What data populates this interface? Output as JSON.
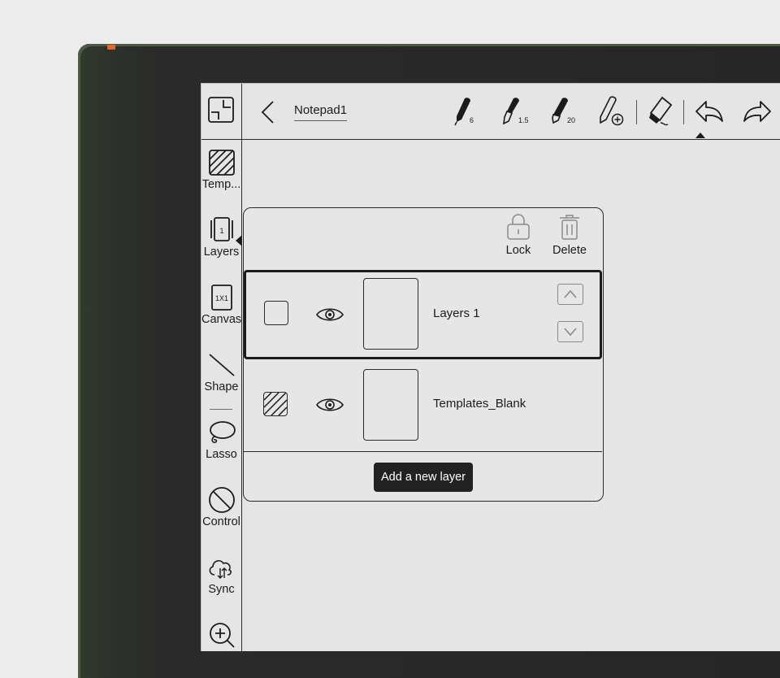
{
  "document": {
    "title": "Notepad1"
  },
  "sidebar": {
    "items": [
      {
        "label": "Temp...",
        "icon": "template-hatched-icon"
      },
      {
        "label": "Layers",
        "icon": "layers-icon",
        "badge": "1"
      },
      {
        "label": "Canvas",
        "icon": "canvas-icon",
        "badge": "1X1"
      },
      {
        "label": "Shape",
        "icon": "line-shape-icon"
      },
      {
        "label": "Lasso",
        "icon": "lasso-icon"
      },
      {
        "label": "Control",
        "icon": "control-circle-icon"
      },
      {
        "label": "Sync",
        "icon": "cloud-sync-icon"
      }
    ]
  },
  "toolbar": {
    "tools": [
      {
        "name": "pen",
        "size": "6"
      },
      {
        "name": "fountain-pen",
        "size": "1.5"
      },
      {
        "name": "marker",
        "size": "20"
      }
    ]
  },
  "layers_panel": {
    "actions": {
      "lock_label": "Lock",
      "delete_label": "Delete"
    },
    "layers": [
      {
        "name": "Layers 1",
        "selected": true,
        "visible": true,
        "template": false
      },
      {
        "name": "Templates_Blank",
        "selected": false,
        "visible": true,
        "template": true
      }
    ],
    "add_layer_label": "Add a new layer"
  },
  "colors": {
    "accent": "#1b1b1b",
    "screen": "#e5e5e5",
    "led": "#e4652a"
  }
}
